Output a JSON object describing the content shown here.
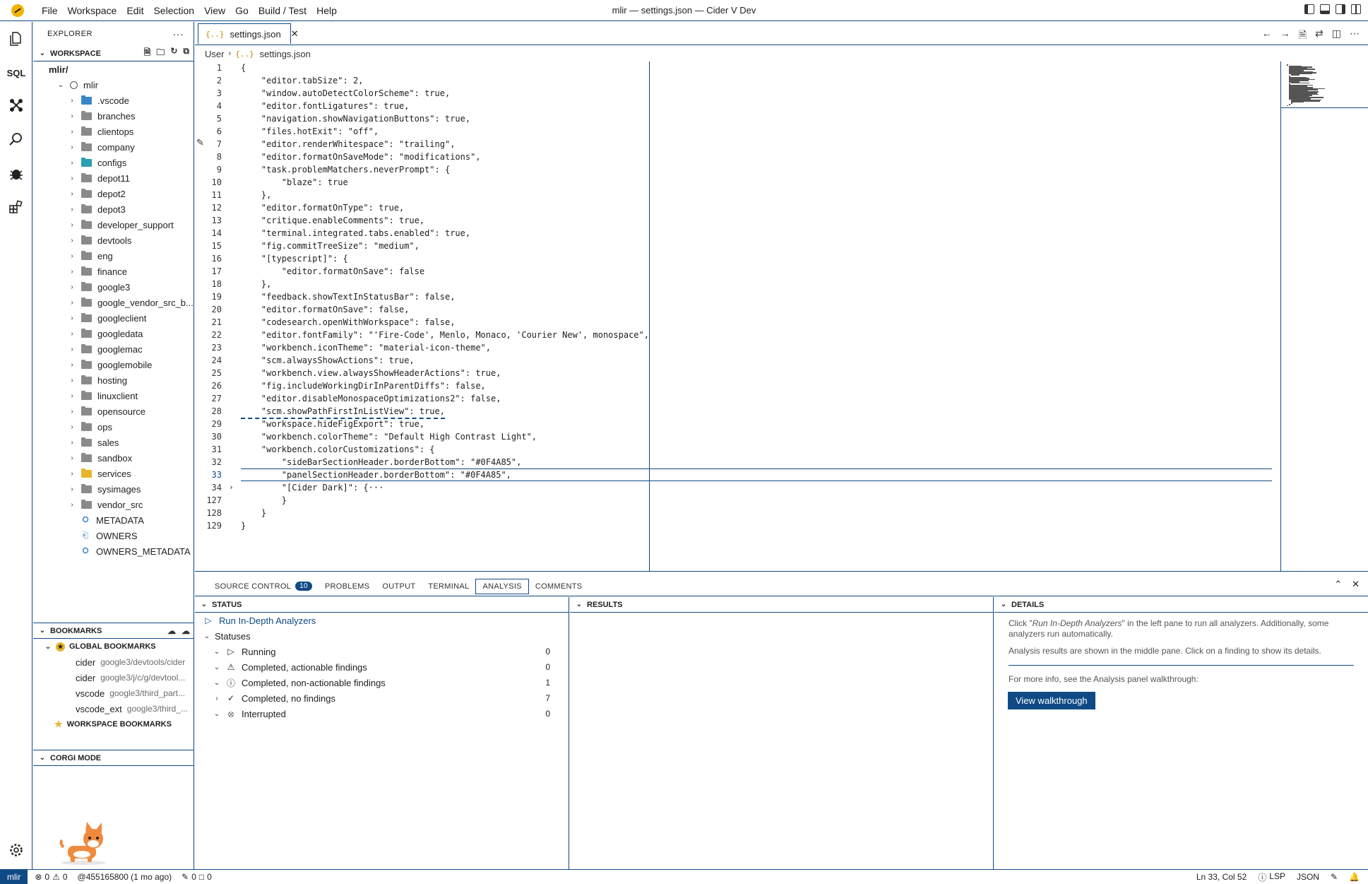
{
  "titlebar": {
    "menu": [
      "File",
      "Workspace",
      "Edit",
      "Selection",
      "View",
      "Go",
      "Build / Test",
      "Help"
    ],
    "window_title": "mlir — settings.json — Cider V Dev"
  },
  "sidebar": {
    "title": "EXPLORER",
    "more": "···",
    "workspace_label": "WORKSPACE",
    "root": "mlir/",
    "repo": "mlir",
    "folders": [
      {
        "name": ".vscode",
        "color": "blue"
      },
      {
        "name": "branches",
        "color": "gray"
      },
      {
        "name": "clientops",
        "color": "gray"
      },
      {
        "name": "company",
        "color": "gray"
      },
      {
        "name": "configs",
        "color": "teal"
      },
      {
        "name": "depot11",
        "color": "gray"
      },
      {
        "name": "depot2",
        "color": "gray"
      },
      {
        "name": "depot3",
        "color": "gray"
      },
      {
        "name": "developer_support",
        "color": "gray"
      },
      {
        "name": "devtools",
        "color": "gray"
      },
      {
        "name": "eng",
        "color": "gray"
      },
      {
        "name": "finance",
        "color": "gray"
      },
      {
        "name": "google3",
        "color": "gray"
      },
      {
        "name": "google_vendor_src_b...",
        "color": "gray"
      },
      {
        "name": "googleclient",
        "color": "gray"
      },
      {
        "name": "googledata",
        "color": "gray"
      },
      {
        "name": "googlemac",
        "color": "gray"
      },
      {
        "name": "googlemobile",
        "color": "gray"
      },
      {
        "name": "hosting",
        "color": "gray"
      },
      {
        "name": "linuxclient",
        "color": "gray"
      },
      {
        "name": "opensource",
        "color": "gray"
      },
      {
        "name": "ops",
        "color": "gray"
      },
      {
        "name": "sales",
        "color": "gray"
      },
      {
        "name": "sandbox",
        "color": "gray"
      },
      {
        "name": "services",
        "color": "yellow"
      },
      {
        "name": "sysimages",
        "color": "gray"
      },
      {
        "name": "vendor_src",
        "color": "gray"
      }
    ],
    "files": [
      {
        "name": "METADATA",
        "icon": "google-icon"
      },
      {
        "name": "OWNERS",
        "icon": "file-icon"
      },
      {
        "name": "OWNERS_METADATA",
        "icon": "google-icon"
      }
    ],
    "bookmarks_label": "BOOKMARKS",
    "global_bookmarks_label": "GLOBAL BOOKMARKS",
    "bookmarks": [
      {
        "name": "cider",
        "path": "google3/devtools/cider"
      },
      {
        "name": "cider",
        "path": "google3/j/c/g/devtool..."
      },
      {
        "name": "vscode",
        "path": "google3/third_part..."
      },
      {
        "name": "vscode_ext",
        "path": "google3/third_..."
      }
    ],
    "workspace_bookmarks_label": "WORKSPACE BOOKMARKS",
    "corgi_label": "CORGI MODE"
  },
  "editor": {
    "tab_label": "settings.json",
    "breadcrumb": [
      "User",
      "settings.json"
    ],
    "lines": [
      {
        "n": "1",
        "t": "{"
      },
      {
        "n": "2",
        "t": "    \"editor.tabSize\": 2,"
      },
      {
        "n": "3",
        "t": "    \"window.autoDetectColorScheme\": true,"
      },
      {
        "n": "4",
        "t": "    \"editor.fontLigatures\": true,"
      },
      {
        "n": "5",
        "t": "    \"navigation.showNavigationButtons\": true,"
      },
      {
        "n": "6",
        "t": "    \"files.hotExit\": \"off\","
      },
      {
        "n": "7",
        "t": "    \"editor.renderWhitespace\": \"trailing\","
      },
      {
        "n": "8",
        "t": "    \"editor.formatOnSaveMode\": \"modifications\","
      },
      {
        "n": "9",
        "t": "    \"task.problemMatchers.neverPrompt\": {"
      },
      {
        "n": "10",
        "t": "        \"blaze\": true"
      },
      {
        "n": "11",
        "t": "    },"
      },
      {
        "n": "12",
        "t": "    \"editor.formatOnType\": true,"
      },
      {
        "n": "13",
        "t": "    \"critique.enableComments\": true,"
      },
      {
        "n": "14",
        "t": "    \"terminal.integrated.tabs.enabled\": true,"
      },
      {
        "n": "15",
        "t": "    \"fig.commitTreeSize\": \"medium\","
      },
      {
        "n": "16",
        "t": "    \"[typescript]\": {"
      },
      {
        "n": "17",
        "t": "        \"editor.formatOnSave\": false"
      },
      {
        "n": "18",
        "t": "    },"
      },
      {
        "n": "19",
        "t": "    \"feedback.showTextInStatusBar\": false,"
      },
      {
        "n": "20",
        "t": "    \"editor.formatOnSave\": false,"
      },
      {
        "n": "21",
        "t": "    \"codesearch.openWithWorkspace\": false,"
      },
      {
        "n": "22",
        "t": "    \"editor.fontFamily\": \"'Fire-Code', Menlo, Monaco, 'Courier New', monospace\","
      },
      {
        "n": "23",
        "t": "    \"workbench.iconTheme\": \"material-icon-theme\","
      },
      {
        "n": "24",
        "t": "    \"scm.alwaysShowActions\": true,"
      },
      {
        "n": "25",
        "t": "    \"workbench.view.alwaysShowHeaderActions\": true,"
      },
      {
        "n": "26",
        "t": "    \"fig.includeWorkingDirInParentDiffs\": false,"
      },
      {
        "n": "27",
        "t": "    \"editor.disableMonospaceOptimizations2\": false,"
      },
      {
        "n": "28",
        "t": "    \"scm.showPathFirstInListView\": true,"
      },
      {
        "n": "29",
        "t": "    \"workspace.hideFigExport\": true,"
      },
      {
        "n": "30",
        "t": "    \"workbench.colorTheme\": \"Default High Contrast Light\","
      },
      {
        "n": "31",
        "t": "    \"workbench.colorCustomizations\": {"
      },
      {
        "n": "32",
        "t": "        \"sideBarSectionHeader.borderBottom\": \"#0F4A85\","
      },
      {
        "n": "33",
        "t": "        \"panelSectionHeader.borderBottom\": \"#0F4A85\","
      },
      {
        "n": "34",
        "t": "        \"[Cider Dark]\": {···"
      },
      {
        "n": "127",
        "t": "        }"
      },
      {
        "n": "128",
        "t": "    }"
      },
      {
        "n": "129",
        "t": "}"
      }
    ]
  },
  "panel": {
    "tabs": [
      {
        "label": "SOURCE CONTROL",
        "badge": "10"
      },
      {
        "label": "PROBLEMS"
      },
      {
        "label": "OUTPUT"
      },
      {
        "label": "TERMINAL"
      },
      {
        "label": "ANALYSIS",
        "active": true
      },
      {
        "label": "COMMENTS"
      }
    ],
    "status_header": "STATUS",
    "results_header": "RESULTS",
    "details_header": "DETAILS",
    "run_label": "Run In-Depth Analyzers",
    "statuses_label": "Statuses",
    "statuses": [
      {
        "label": "Running",
        "count": "0",
        "icon": "play-icon"
      },
      {
        "label": "Completed, actionable findings",
        "count": "0",
        "icon": "warning-icon"
      },
      {
        "label": "Completed, non-actionable findings",
        "count": "1",
        "icon": "info-icon"
      },
      {
        "label": "Completed, no findings",
        "count": "7",
        "icon": "check-icon"
      },
      {
        "label": "Interrupted",
        "count": "0",
        "icon": "interrupted-icon"
      }
    ],
    "details_p1_prefix": "Click \"",
    "details_p1_em": "Run In-Depth Analyzers",
    "details_p1_suffix": "\" in the left pane to run all analyzers. Additionally, some analyzers run automatically.",
    "details_p2": "Analysis results are shown in the middle pane. Click on a finding to show its details.",
    "details_p3": "For more info, see the Analysis panel walkthrough:",
    "walkthrough_button": "View walkthrough"
  },
  "statusbar": {
    "remote": "mlir",
    "errors": "0",
    "warnings": "0",
    "commit": "@455165800 (1 mo ago)",
    "edits": "0",
    "comments": "0",
    "position": "Ln 33, Col 52",
    "lsp": "LSP",
    "language": "JSON"
  },
  "colors": {
    "accent": "#0F4A85"
  }
}
